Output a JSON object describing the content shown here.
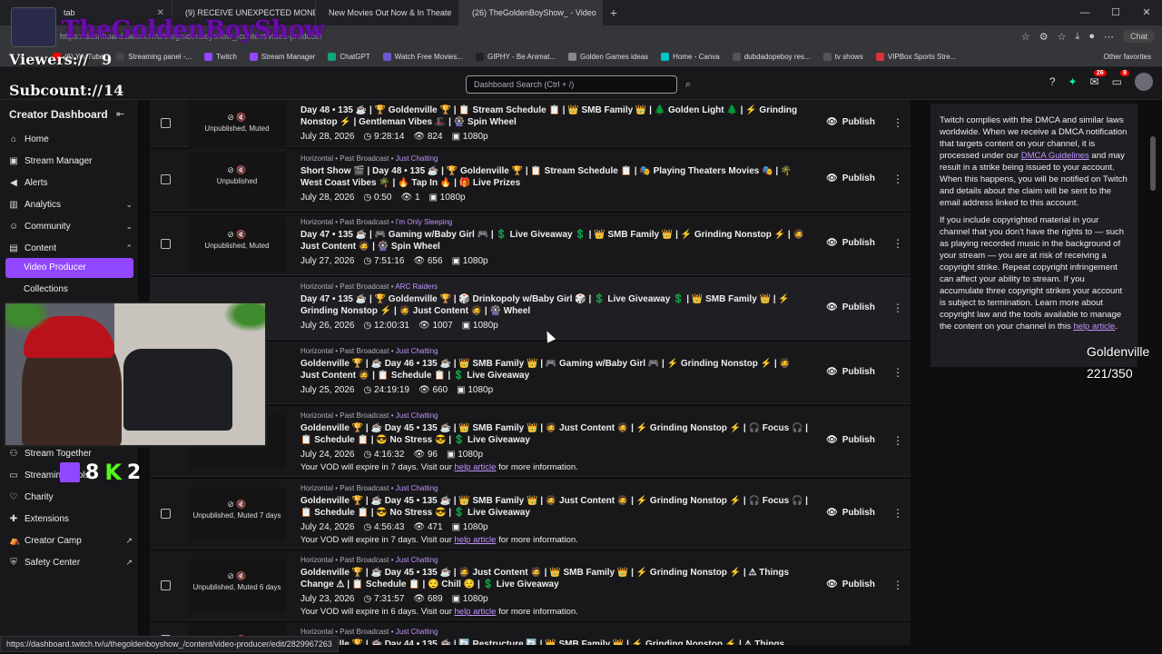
{
  "browser": {
    "tabs": [
      {
        "title": "tab",
        "color": "#666"
      },
      {
        "title": "(9) RECEIVE UNEXPECTED MONEY",
        "color": "#ff0000"
      },
      {
        "title": "New Movies Out Now & In Theate",
        "color": "#e44"
      },
      {
        "title": "(26) TheGoldenBoyShow_ - Video",
        "color": "#9147ff"
      }
    ],
    "address": "https://dashboard.twitch.tv/u/thegoldenboyshow_/content/video-producer",
    "chat_label": "Chat",
    "bookmarks": [
      {
        "label": "(6) YouTube",
        "color": "#ff0000"
      },
      {
        "label": "Streaming panel -...",
        "color": "#444"
      },
      {
        "label": "Twitch",
        "color": "#9147ff"
      },
      {
        "label": "Stream Manager",
        "color": "#9147ff"
      },
      {
        "label": "ChatGPT",
        "color": "#10a37f"
      },
      {
        "label": "Watch Free Movies...",
        "color": "#6a5acd"
      },
      {
        "label": "GIPHY - Be Animat...",
        "color": "#222"
      },
      {
        "label": "Golden Games ideas",
        "color": "#888"
      },
      {
        "label": "Home - Canva",
        "color": "#00c4cc"
      },
      {
        "label": "dubdadopeboy res...",
        "color": "#555"
      },
      {
        "label": "tv shows",
        "color": "#555"
      },
      {
        "label": "VIPBox Sports Stre...",
        "color": "#d33"
      }
    ],
    "other_bookmarks": "Other favorites",
    "status_url": "https://dashboard.twitch.tv/u/thegoldenboyshow_/content/video-producer/edit/2829967263"
  },
  "header": {
    "search_placeholder": "Dashboard Search (Ctrl + /)",
    "badge_inbox": "26",
    "badge_notif": "8"
  },
  "sidebar": {
    "page_title": "Video Producer",
    "title": "Creator Dashboard",
    "items": [
      "Home",
      "Stream Manager",
      "Alerts",
      "Analytics",
      "Community",
      "Content"
    ],
    "sub_active": "Video Producer",
    "sub_items": [
      "Collections"
    ],
    "lower_items": [
      "Stream Together",
      "Streaming Tools",
      "Charity",
      "Extensions",
      "Creator Camp",
      "Safety Center"
    ]
  },
  "videos": [
    {
      "meta_prefix": "",
      "category": "",
      "thumb": "Unpublished, Muted",
      "title": "Day 48 • 135 ☕ | 🏆 Goldenville 🏆 | 📋 Stream Schedule 📋 | 👑 SMB Family 👑 | 🌲 Golden Light 🌲 | ⚡ Grinding Nonstop ⚡ | Gentleman Vibes 🎩 | 🎡 Spin Wheel",
      "date": "July 28, 2026",
      "duration": "9:28:14",
      "views": "824",
      "res": "1080p",
      "note": ""
    },
    {
      "meta_prefix": "Horizontal • Past Broadcast •",
      "category": "Just Chatting",
      "thumb": "Unpublished",
      "title": "Short Show 🎬 | Day 48 • 135 ☕ | 🏆 Goldenville 🏆 | 📋 Stream Schedule 📋 | 🎭 Playing Theaters Movies 🎭 | 🌴 West Coast Vibes 🌴 | 🔥 Tap In 🔥 | 🎁 Live Prizes",
      "date": "July 28, 2026",
      "duration": "0:50",
      "views": "1",
      "res": "1080p",
      "note": ""
    },
    {
      "meta_prefix": "Horizontal • Past Broadcast •",
      "category": "I'm Only Sleeping",
      "thumb": "Unpublished, Muted",
      "title": "Day 47 • 135 ☕ | 🎮 Gaming w/Baby Girl 🎮 | 💲 Live Giveaway 💲 | 👑 SMB Family 👑 | ⚡ Grinding Nonstop ⚡ | 🧔 Just Content 🧔 | 🎡 Spin Wheel",
      "date": "July 27, 2026",
      "duration": "7:51:16",
      "views": "656",
      "res": "1080p",
      "note": ""
    },
    {
      "meta_prefix": "Horizontal • Past Broadcast •",
      "category": "ARC Raiders",
      "thumb": "",
      "title": "Day 47 • 135 ☕ | 🏆 Goldenville 🏆 | 🎲 Drinkopoly w/Baby Girl 🎲 | 💲 Live Giveaway 💲 | 👑 SMB Family 👑 | ⚡ Grinding Nonstop ⚡ | 🧔 Just Content 🧔 | 🎡 Wheel",
      "date": "July 26, 2026",
      "duration": "12:00:31",
      "views": "1007",
      "res": "1080p",
      "note": ""
    },
    {
      "meta_prefix": "Horizontal • Past Broadcast •",
      "category": "Just Chatting",
      "thumb": "",
      "title": "Goldenville 🏆 | ☕ Day 46 • 135 ☕ | 👑 SMB Family 👑 | 🎮 Gaming w/Baby Girl 🎮 | ⚡ Grinding Nonstop ⚡ | 🧔 Just Content 🧔 | 📋 Schedule 📋 | 💲 Live Giveaway",
      "date": "July 25, 2026",
      "duration": "24:19:19",
      "views": "660",
      "res": "1080p",
      "note": ""
    },
    {
      "meta_prefix": "Horizontal • Past Broadcast •",
      "category": "Just Chatting",
      "thumb": "7 days",
      "title": "Goldenville 🏆 | ☕ Day 45 • 135 ☕ | 👑 SMB Family 👑 | 🧔 Just Content 🧔 | ⚡ Grinding Nonstop ⚡ | 🎧 Focus 🎧 | 📋 Schedule 📋 | 😎 No Stress 😎 | 💲 Live Giveaway",
      "date": "July 24, 2026",
      "duration": "4:16:32",
      "views": "96",
      "res": "1080p",
      "note": "Your VOD will expire in 7 days. Visit our"
    },
    {
      "meta_prefix": "Horizontal • Past Broadcast •",
      "category": "Just Chatting",
      "thumb": "Unpublished, Muted 7 days",
      "title": "Goldenville 🏆 | ☕ Day 45 • 135 ☕ | 👑 SMB Family 👑 | 🧔 Just Content 🧔 | ⚡ Grinding Nonstop ⚡ | 🎧 Focus 🎧 | 📋 Schedule 📋 | 😎 No Stress 😎 | 💲 Live Giveaway",
      "date": "July 24, 2026",
      "duration": "4:56:43",
      "views": "471",
      "res": "1080p",
      "note": "Your VOD will expire in 7 days. Visit our"
    },
    {
      "meta_prefix": "Horizontal • Past Broadcast •",
      "category": "Just Chatting",
      "thumb": "Unpublished, Muted 6 days",
      "title": "Goldenville 🏆 | ☕ Day 45 • 135 ☕ | 🧔 Just Content 🧔 | 👑 SMB Family 👑 | ⚡ Grinding Nonstop ⚡ | ⚠ Things Change ⚠ | 📋 Schedule 📋 | 😌 Chill 😌 | 💲 Live Giveaway",
      "date": "July 23, 2026",
      "duration": "7:31:57",
      "views": "689",
      "res": "1080p",
      "note": "Your VOD will expire in 6 days. Visit our"
    },
    {
      "meta_prefix": "Horizontal • Past Broadcast •",
      "category": "Just Chatting",
      "thumb": "",
      "title": "Goldenville 🏆 | ☕ Day 44 • 135 ☕ | 🔄 Restructure 🔄 | 👑 SMB Family 👑 | ⚡ Grinding Nonstop ⚡ | ⚠ Things Change ⚠ | 📋",
      "date": "",
      "duration": "",
      "views": "",
      "res": "",
      "note": ""
    }
  ],
  "labels": {
    "publish": "Publish",
    "help_article": "help article",
    "more_info": "for more information."
  },
  "dmca": {
    "p1_a": "Twitch complies with the DMCA and similar laws worldwide. When we receive a DMCA notification that targets content on your channel, it is processed under our",
    "p1_link": "DMCA Guidelines",
    "p1_b": "and may result in a strike being issued to your account. When this happens, you will be notified on Twitch and details about the claim will be sent to the email address linked to this account.",
    "p2_a": "If you include copyrighted material in your channel that you don't have the rights to — such as playing recorded music in the background of your stream — you are at risk of receiving a copyright strike. Repeat copyright infringement can affect your ability to stream. If you accumulate three copyright strikes your account is subject to termination. Learn more about copyright law and the tools available to manage the content on your channel in this",
    "p2_link": "help article",
    "p2_b": "."
  },
  "overlay": {
    "channel_name": "TheGoldenBoyShow",
    "viewers_label": "Viewers://",
    "viewers_value": "9",
    "subs_label": "Subcount://",
    "subs_value": "14",
    "twitch_count": "8",
    "kick_count": "2",
    "goal_name": "Goldenville",
    "goal_progress": "221/350"
  }
}
